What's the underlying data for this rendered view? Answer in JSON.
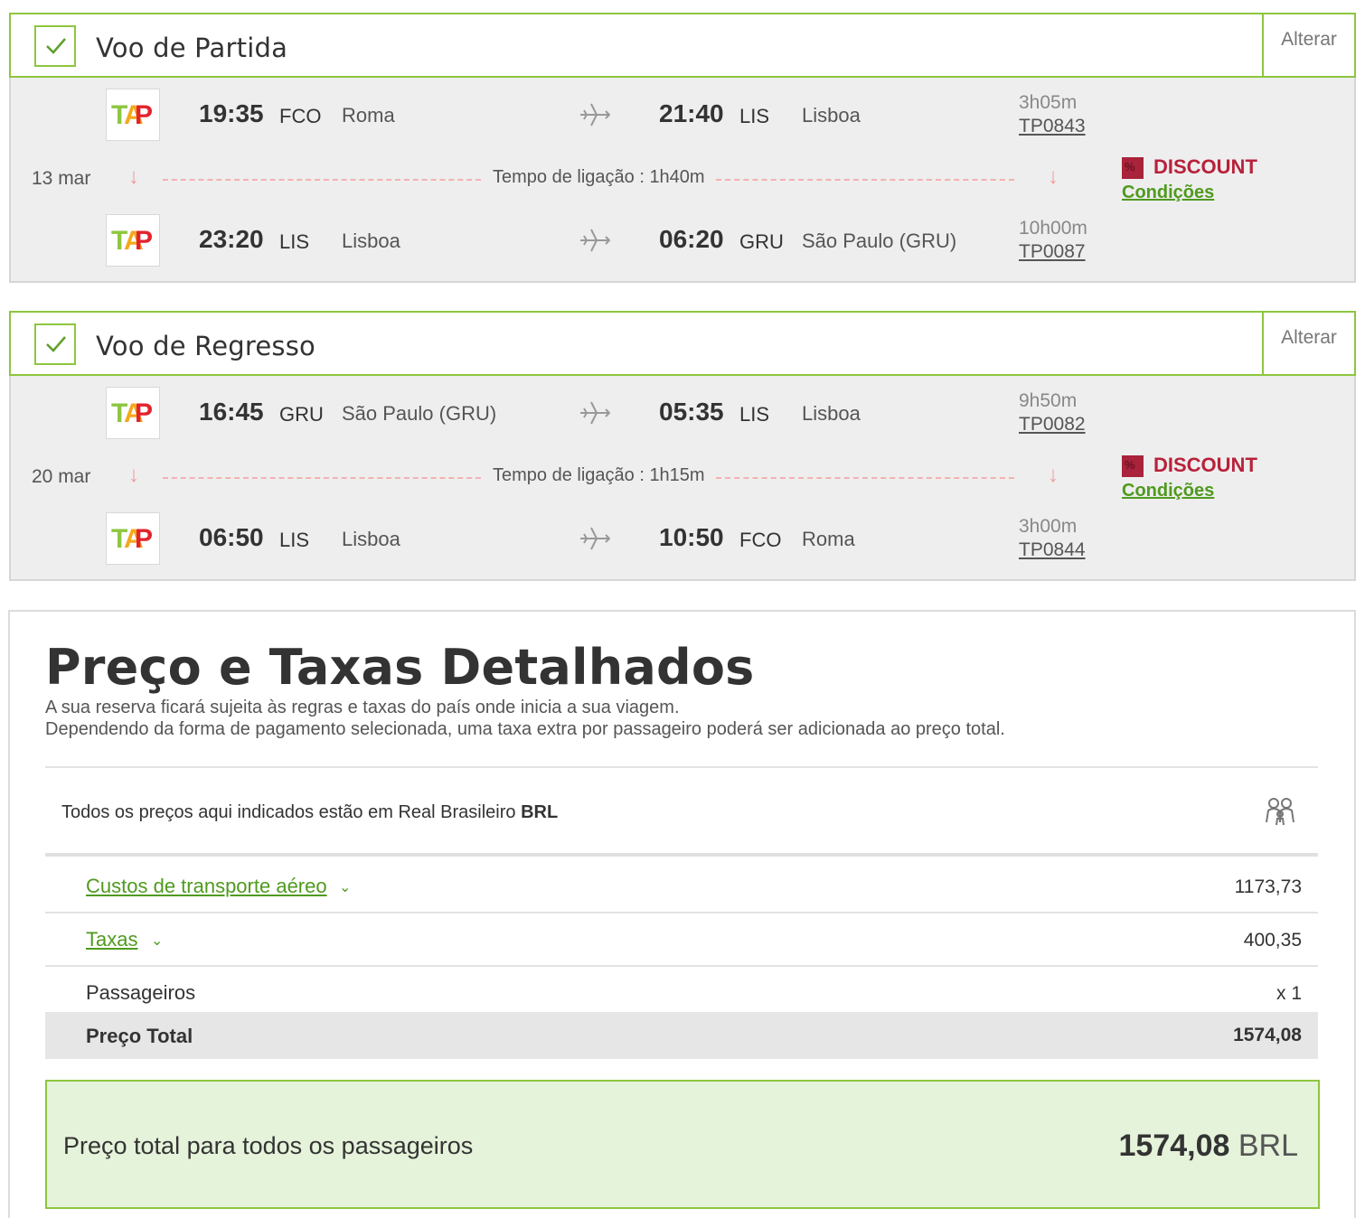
{
  "outbound": {
    "title": "Voo de Partida",
    "change_label": "Alterar",
    "date": "13 mar",
    "connection": "Tempo de ligação : 1h40m",
    "discount": "DISCOUNT",
    "discount_badge": "%",
    "conditions": "Condições",
    "segments": [
      {
        "dep_time": "19:35",
        "dep_code": "FCO",
        "dep_city": "Roma",
        "arr_time": "21:40",
        "arr_code": "LIS",
        "arr_city": "Lisboa",
        "duration": "3h05m",
        "flight": "TP0843"
      },
      {
        "dep_time": "23:20",
        "dep_code": "LIS",
        "dep_city": "Lisboa",
        "arr_time": "06:20",
        "arr_code": "GRU",
        "arr_city": "São Paulo (GRU)",
        "duration": "10h00m",
        "flight": "TP0087"
      }
    ]
  },
  "inbound": {
    "title": "Voo de Regresso",
    "change_label": "Alterar",
    "date": "20 mar",
    "connection": "Tempo de ligação : 1h15m",
    "discount": "DISCOUNT",
    "discount_badge": "%",
    "conditions": "Condições",
    "segments": [
      {
        "dep_time": "16:45",
        "dep_code": "GRU",
        "dep_city": "São Paulo (GRU)",
        "arr_time": "05:35",
        "arr_code": "LIS",
        "arr_city": "Lisboa",
        "duration": "9h50m",
        "flight": "TP0082"
      },
      {
        "dep_time": "06:50",
        "dep_code": "LIS",
        "dep_city": "Lisboa",
        "arr_time": "10:50",
        "arr_code": "FCO",
        "arr_city": "Roma",
        "duration": "3h00m",
        "flight": "TP0844"
      }
    ]
  },
  "colors": {
    "accent_green": "#8dc63f",
    "link_green": "#4f9a1f",
    "discount_red": "#b8213a",
    "tap_red": "#e3232c",
    "tap_green": "#8dc63f"
  },
  "price": {
    "title": "Preço e Taxas Detalhados",
    "note1": "A sua reserva ficará sujeita às regras e taxas do país onde inicia a sua viagem.",
    "note2": "Dependendo da forma de pagamento selecionada, uma taxa extra por passageiro poderá ser adicionada ao preço total.",
    "currency_prefix": "Todos os preços aqui indicados estão em Real Brasileiro",
    "currency_code": "BRL",
    "rows": [
      {
        "label": "Custos de transporte aéreo",
        "value": "1173,73"
      },
      {
        "label": "Taxas",
        "value": "400,35"
      },
      {
        "label": "Passageiros",
        "value": "x 1"
      },
      {
        "label": "Preço Total",
        "value": "1574,08"
      }
    ],
    "grand_label": "Preço total para todos os passageiros",
    "grand_value": "1574,08",
    "grand_currency": "BRL"
  }
}
